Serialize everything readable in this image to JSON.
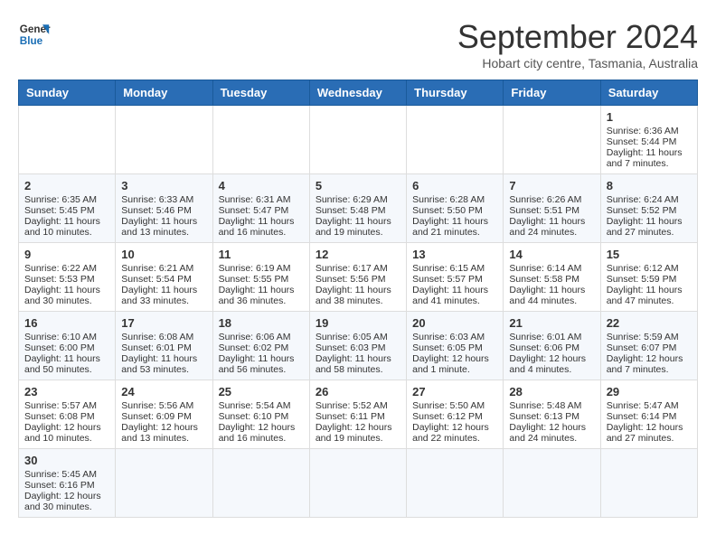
{
  "header": {
    "logo_line1": "General",
    "logo_line2": "Blue",
    "title": "September 2024",
    "subtitle": "Hobart city centre, Tasmania, Australia"
  },
  "calendar": {
    "days_of_week": [
      "Sunday",
      "Monday",
      "Tuesday",
      "Wednesday",
      "Thursday",
      "Friday",
      "Saturday"
    ],
    "weeks": [
      [
        {
          "day": "",
          "info": ""
        },
        {
          "day": "",
          "info": ""
        },
        {
          "day": "",
          "info": ""
        },
        {
          "day": "",
          "info": ""
        },
        {
          "day": "",
          "info": ""
        },
        {
          "day": "",
          "info": ""
        },
        {
          "day": "1",
          "info": "Sunrise: 6:36 AM\nSunset: 5:44 PM\nDaylight: 11 hours\nand 7 minutes."
        }
      ],
      [
        {
          "day": "2",
          "info": "Sunrise: 6:35 AM\nSunset: 5:45 PM\nDaylight: 11 hours\nand 10 minutes."
        },
        {
          "day": "3",
          "info": "Sunrise: 6:33 AM\nSunset: 5:46 PM\nDaylight: 11 hours\nand 13 minutes."
        },
        {
          "day": "4",
          "info": "Sunrise: 6:31 AM\nSunset: 5:47 PM\nDaylight: 11 hours\nand 16 minutes."
        },
        {
          "day": "5",
          "info": "Sunrise: 6:29 AM\nSunset: 5:48 PM\nDaylight: 11 hours\nand 19 minutes."
        },
        {
          "day": "6",
          "info": "Sunrise: 6:28 AM\nSunset: 5:50 PM\nDaylight: 11 hours\nand 21 minutes."
        },
        {
          "day": "7",
          "info": "Sunrise: 6:26 AM\nSunset: 5:51 PM\nDaylight: 11 hours\nand 24 minutes."
        },
        {
          "day": "8",
          "info": "Sunrise: 6:24 AM\nSunset: 5:52 PM\nDaylight: 11 hours\nand 27 minutes."
        }
      ],
      [
        {
          "day": "9",
          "info": "Sunrise: 6:22 AM\nSunset: 5:53 PM\nDaylight: 11 hours\nand 30 minutes."
        },
        {
          "day": "10",
          "info": "Sunrise: 6:21 AM\nSunset: 5:54 PM\nDaylight: 11 hours\nand 33 minutes."
        },
        {
          "day": "11",
          "info": "Sunrise: 6:19 AM\nSunset: 5:55 PM\nDaylight: 11 hours\nand 36 minutes."
        },
        {
          "day": "12",
          "info": "Sunrise: 6:17 AM\nSunset: 5:56 PM\nDaylight: 11 hours\nand 38 minutes."
        },
        {
          "day": "13",
          "info": "Sunrise: 6:15 AM\nSunset: 5:57 PM\nDaylight: 11 hours\nand 41 minutes."
        },
        {
          "day": "14",
          "info": "Sunrise: 6:14 AM\nSunset: 5:58 PM\nDaylight: 11 hours\nand 44 minutes."
        },
        {
          "day": "15",
          "info": "Sunrise: 6:12 AM\nSunset: 5:59 PM\nDaylight: 11 hours\nand 47 minutes."
        }
      ],
      [
        {
          "day": "16",
          "info": "Sunrise: 6:10 AM\nSunset: 6:00 PM\nDaylight: 11 hours\nand 50 minutes."
        },
        {
          "day": "17",
          "info": "Sunrise: 6:08 AM\nSunset: 6:01 PM\nDaylight: 11 hours\nand 53 minutes."
        },
        {
          "day": "18",
          "info": "Sunrise: 6:06 AM\nSunset: 6:02 PM\nDaylight: 11 hours\nand 56 minutes."
        },
        {
          "day": "19",
          "info": "Sunrise: 6:05 AM\nSunset: 6:03 PM\nDaylight: 11 hours\nand 58 minutes."
        },
        {
          "day": "20",
          "info": "Sunrise: 6:03 AM\nSunset: 6:05 PM\nDaylight: 12 hours\nand 1 minute."
        },
        {
          "day": "21",
          "info": "Sunrise: 6:01 AM\nSunset: 6:06 PM\nDaylight: 12 hours\nand 4 minutes."
        },
        {
          "day": "22",
          "info": "Sunrise: 5:59 AM\nSunset: 6:07 PM\nDaylight: 12 hours\nand 7 minutes."
        }
      ],
      [
        {
          "day": "23",
          "info": "Sunrise: 5:57 AM\nSunset: 6:08 PM\nDaylight: 12 hours\nand 10 minutes."
        },
        {
          "day": "24",
          "info": "Sunrise: 5:56 AM\nSunset: 6:09 PM\nDaylight: 12 hours\nand 13 minutes."
        },
        {
          "day": "25",
          "info": "Sunrise: 5:54 AM\nSunset: 6:10 PM\nDaylight: 12 hours\nand 16 minutes."
        },
        {
          "day": "26",
          "info": "Sunrise: 5:52 AM\nSunset: 6:11 PM\nDaylight: 12 hours\nand 19 minutes."
        },
        {
          "day": "27",
          "info": "Sunrise: 5:50 AM\nSunset: 6:12 PM\nDaylight: 12 hours\nand 22 minutes."
        },
        {
          "day": "28",
          "info": "Sunrise: 5:48 AM\nSunset: 6:13 PM\nDaylight: 12 hours\nand 24 minutes."
        },
        {
          "day": "29",
          "info": "Sunrise: 5:47 AM\nSunset: 6:14 PM\nDaylight: 12 hours\nand 27 minutes."
        }
      ],
      [
        {
          "day": "30",
          "info": "Sunrise: 5:45 AM\nSunset: 6:16 PM\nDaylight: 12 hours\nand 30 minutes."
        },
        {
          "day": "",
          "info": ""
        },
        {
          "day": "",
          "info": ""
        },
        {
          "day": "",
          "info": ""
        },
        {
          "day": "",
          "info": ""
        },
        {
          "day": "",
          "info": ""
        },
        {
          "day": "",
          "info": ""
        }
      ]
    ]
  }
}
